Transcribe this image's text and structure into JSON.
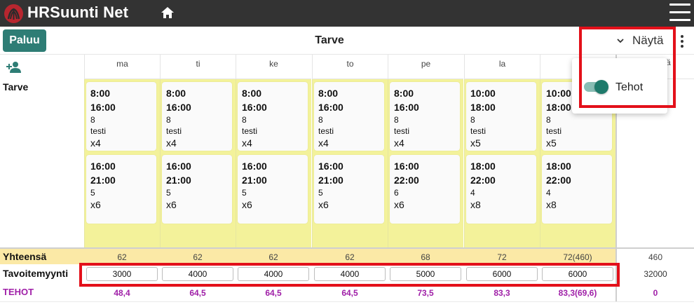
{
  "app": {
    "title": "HRSuunti Net"
  },
  "toolbar": {
    "back_label": "Paluu",
    "title": "Tarve",
    "show_label": "Näytä"
  },
  "days": [
    "ma",
    "ti",
    "ke",
    "to",
    "pe",
    "la",
    ""
  ],
  "hidden_header_fragment": "ä",
  "rows": {
    "demand": "Tarve",
    "total": "Yhteensä",
    "target": "Tavoitemyynti",
    "efficiency": "TEHOT"
  },
  "shifts": [
    [
      {
        "start": "8:00",
        "end": "16:00",
        "count": "8",
        "note": "testi",
        "mult": "x4"
      },
      {
        "start": "16:00",
        "end": "21:00",
        "count": "5",
        "mult": "x6"
      }
    ],
    [
      {
        "start": "8:00",
        "end": "16:00",
        "count": "8",
        "note": "testi",
        "mult": "x4"
      },
      {
        "start": "16:00",
        "end": "21:00",
        "count": "5",
        "mult": "x6"
      }
    ],
    [
      {
        "start": "8:00",
        "end": "16:00",
        "count": "8",
        "note": "testi",
        "mult": "x4"
      },
      {
        "start": "16:00",
        "end": "21:00",
        "count": "5",
        "mult": "x6"
      }
    ],
    [
      {
        "start": "8:00",
        "end": "16:00",
        "count": "8",
        "note": "testi",
        "mult": "x4"
      },
      {
        "start": "16:00",
        "end": "21:00",
        "count": "5",
        "mult": "x6"
      }
    ],
    [
      {
        "start": "8:00",
        "end": "16:00",
        "count": "8",
        "note": "testi",
        "mult": "x4"
      },
      {
        "start": "16:00",
        "end": "22:00",
        "count": "6",
        "mult": "x6"
      }
    ],
    [
      {
        "start": "10:00",
        "end": "18:00",
        "count": "8",
        "note": "testi",
        "mult": "x5"
      },
      {
        "start": "18:00",
        "end": "22:00",
        "count": "4",
        "mult": "x8"
      }
    ],
    [
      {
        "start": "10:00",
        "end": "18:00",
        "count": "8",
        "note": "testi",
        "mult": "x5"
      },
      {
        "start": "18:00",
        "end": "22:00",
        "count": "4",
        "mult": "x8"
      }
    ]
  ],
  "totals": [
    "62",
    "62",
    "62",
    "62",
    "68",
    "72",
    "72(460)"
  ],
  "grand_total": "460",
  "targets": [
    "3000",
    "4000",
    "4000",
    "4000",
    "5000",
    "6000",
    "6000"
  ],
  "target_total": "32000",
  "efficiency": [
    "48,4",
    "64,5",
    "64,5",
    "64,5",
    "73,5",
    "83,3",
    "83,3(69,6)"
  ],
  "efficiency_total": "0",
  "dropdown": {
    "switch_label": "Tehot",
    "switch_on": true
  },
  "colors": {
    "topbar": "#333333",
    "accent": "#2e7d75",
    "demand_bg": "#f3f29a",
    "sum_bg": "#fbe9a6",
    "efficiency": "#a020a8",
    "highlight": "#e3101a"
  }
}
